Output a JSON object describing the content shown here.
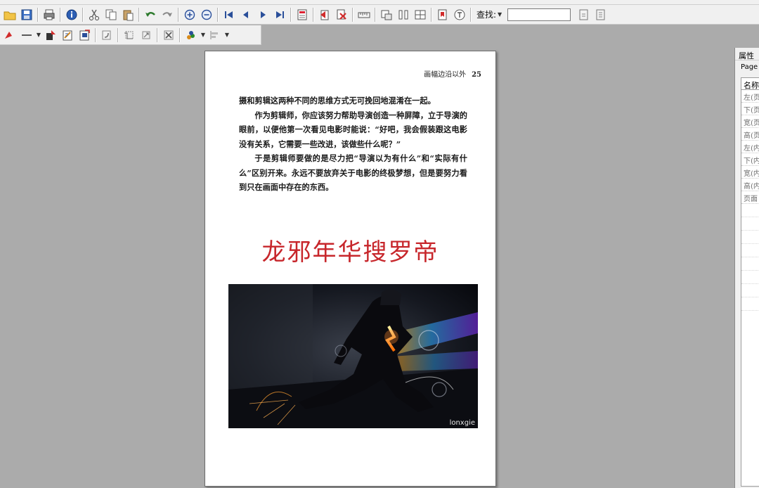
{
  "toolbar1": {
    "buttons": [
      "open-icon",
      "save-icon",
      "print-icon",
      "info-icon",
      "cut-icon",
      "copy-icon",
      "paste-icon",
      "undo-icon",
      "redo-icon",
      "zoom-in-icon",
      "zoom-out-icon",
      "first-page-icon",
      "prev-page-icon",
      "next-page-icon",
      "last-page-icon",
      "calculator-icon",
      "flip-page-icon",
      "delete-page-icon",
      "ruler-icon",
      "image-tool-icon",
      "columns-icon",
      "split-icon",
      "bookmark-icon",
      "text-tool-icon"
    ],
    "find_label": "查找:",
    "find_value": ""
  },
  "toolbar2": {
    "buttons": [
      "color-fill-icon",
      "line-style-icon",
      "shape-icon",
      "edit-page-icon",
      "export-icon",
      "rotate-icon",
      "crop-icon",
      "resize-icon",
      "delete-object-icon",
      "color-picker-icon",
      "align-icon"
    ]
  },
  "page": {
    "running_head": "画幅边沿以外",
    "page_number": "25",
    "paragraphs": [
      "摄和剪辑这两种不同的思维方式无可挽回地混淆在一起。",
      "作为剪辑师，你应该努力帮助导演创造一种屏障，立于导演的眼前，以便他第一次看见电影时能说：“好吧，我会假装跟这电影没有关系，它需要一些改进，该做些什么呢？”",
      "于是剪辑师要做的是尽力把“导演以为有什么”和“实际有什么”区别开来。永远不要放弃关于电影的终极梦想，但是要努力看到只在画面中存在的东西。"
    ],
    "big_title": "龙邪年华搜罗帝",
    "photo_watermark": "lonxgie"
  },
  "properties": {
    "title": "属性",
    "subtitle": "Page",
    "column_header": "名称",
    "rows": [
      "左(页",
      "下(页",
      "宽(页",
      "高(页",
      "左(内",
      "下(内",
      "宽(内",
      "高(内",
      "页面"
    ]
  },
  "colors": {
    "accent_title": "#c7262b",
    "workspace_bg": "#ababab",
    "toolbar_bg": "#f0f0f0"
  }
}
